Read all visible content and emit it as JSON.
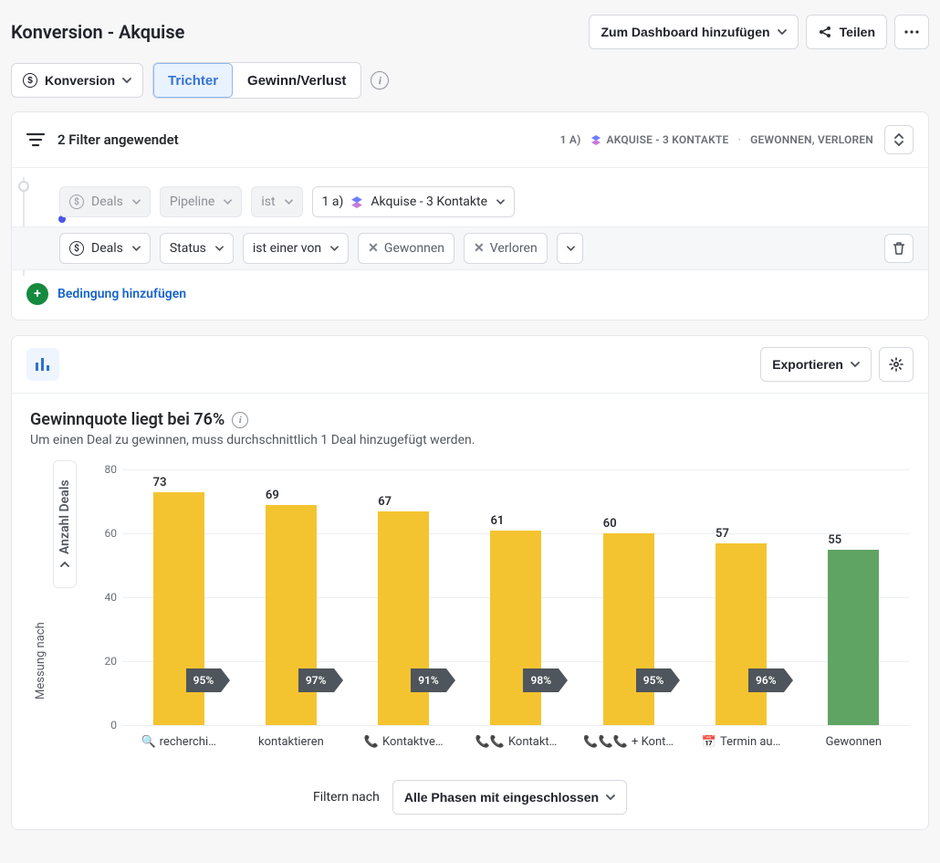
{
  "header": {
    "title": "Konversion - Akquise",
    "add_to_dashboard": "Zum Dashboard hinzufügen",
    "share": "Teilen"
  },
  "view_switch": {
    "konversion": "Konversion",
    "trichter": "Trichter",
    "gewinn_verlust": "Gewinn/Verlust"
  },
  "filters": {
    "applied_label": "2 Filter angewendet",
    "summary_prefix": "1 A)",
    "summary_pipeline": "AKQUISE - 3 KONTAKTE",
    "summary_status": "GEWONNEN, VERLOREN",
    "row1": {
      "entity": "Deals",
      "field": "Pipeline",
      "op": "ist",
      "value": "1 a)",
      "value_label": "Akquise - 3 Kontakte"
    },
    "row2": {
      "entity": "Deals",
      "field": "Status",
      "op": "ist einer von",
      "tag1": "Gewonnen",
      "tag2": "Verloren"
    },
    "add_condition": "Bedingung hinzufügen"
  },
  "chart_head": {
    "export": "Exportieren"
  },
  "chart": {
    "title": "Gewinnquote liegt bei 76%",
    "subtitle": "Um einen Deal zu gewinnen, muss durchschnittlich 1 Deal hinzugefügt werden.",
    "ylabel": "Anzahl Deals",
    "measure_label": "Messung nach",
    "footer_label": "Filtern nach",
    "footer_select": "Alle Phasen mit eingeschlossen"
  },
  "chart_data": {
    "type": "bar",
    "title": "Gewinnquote liegt bei 76%",
    "ylabel": "Anzahl Deals",
    "xlabel": "",
    "ylim": [
      0,
      80
    ],
    "yticks": [
      0,
      20,
      40,
      60,
      80
    ],
    "categories": [
      "recherchi…",
      "kontaktieren",
      "Kontaktve…",
      "Kontakt…",
      "+ Kont…",
      "Termin au…",
      "Gewonnen"
    ],
    "category_icons": [
      "🔍",
      "",
      "📞",
      "📞📞",
      "📞📞📞",
      "📅",
      ""
    ],
    "values": [
      73,
      69,
      67,
      61,
      60,
      57,
      55
    ],
    "conversion_between": [
      "95%",
      "97%",
      "91%",
      "98%",
      "95%",
      "96%"
    ],
    "won_index": 6,
    "overall_win_rate": "76%"
  }
}
